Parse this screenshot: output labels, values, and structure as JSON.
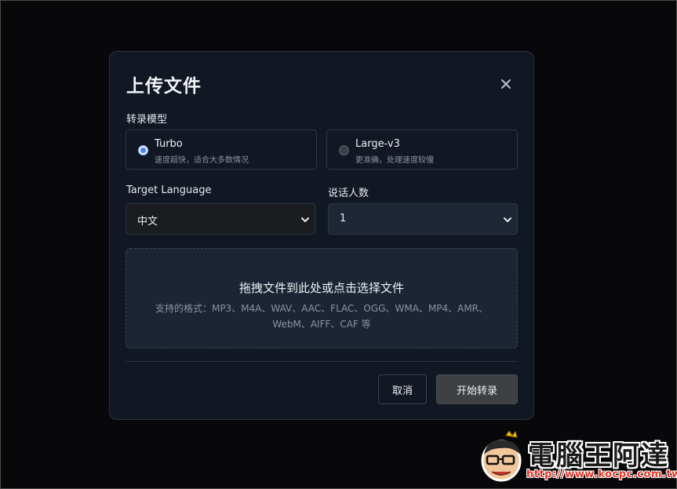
{
  "modal": {
    "title": "上传文件",
    "model_label": "转录模型",
    "models": [
      {
        "name": "Turbo",
        "desc": "速度超快，适合大多数情况",
        "selected": true
      },
      {
        "name": "Large-v3",
        "desc": "更准确，处理速度较慢",
        "selected": false
      }
    ],
    "target_language_label": "Target Language",
    "target_language_value": "中文",
    "speakers_label": "说话人数",
    "speakers_value": "1",
    "dropzone": {
      "title": "拖拽文件到此处或点击选择文件",
      "formats": "支持的格式：MP3、M4A、WAV、AAC、FLAC、OGG、WMA、MP4、AMR、WebM、AIFF、CAF 等"
    },
    "cancel_label": "取消",
    "start_label": "开始转录"
  },
  "watermark": {
    "brand": "電腦王阿達",
    "url": "http://www.kocpc.com.tw"
  },
  "colors": {
    "modal_bg": "#111723",
    "dropzone_bg": "#1b2534",
    "radio_accent": "#4d86e6",
    "watermark_url": "#e23a2d"
  },
  "icons": {
    "close": "close-icon",
    "select": "chevron-down-icon"
  }
}
